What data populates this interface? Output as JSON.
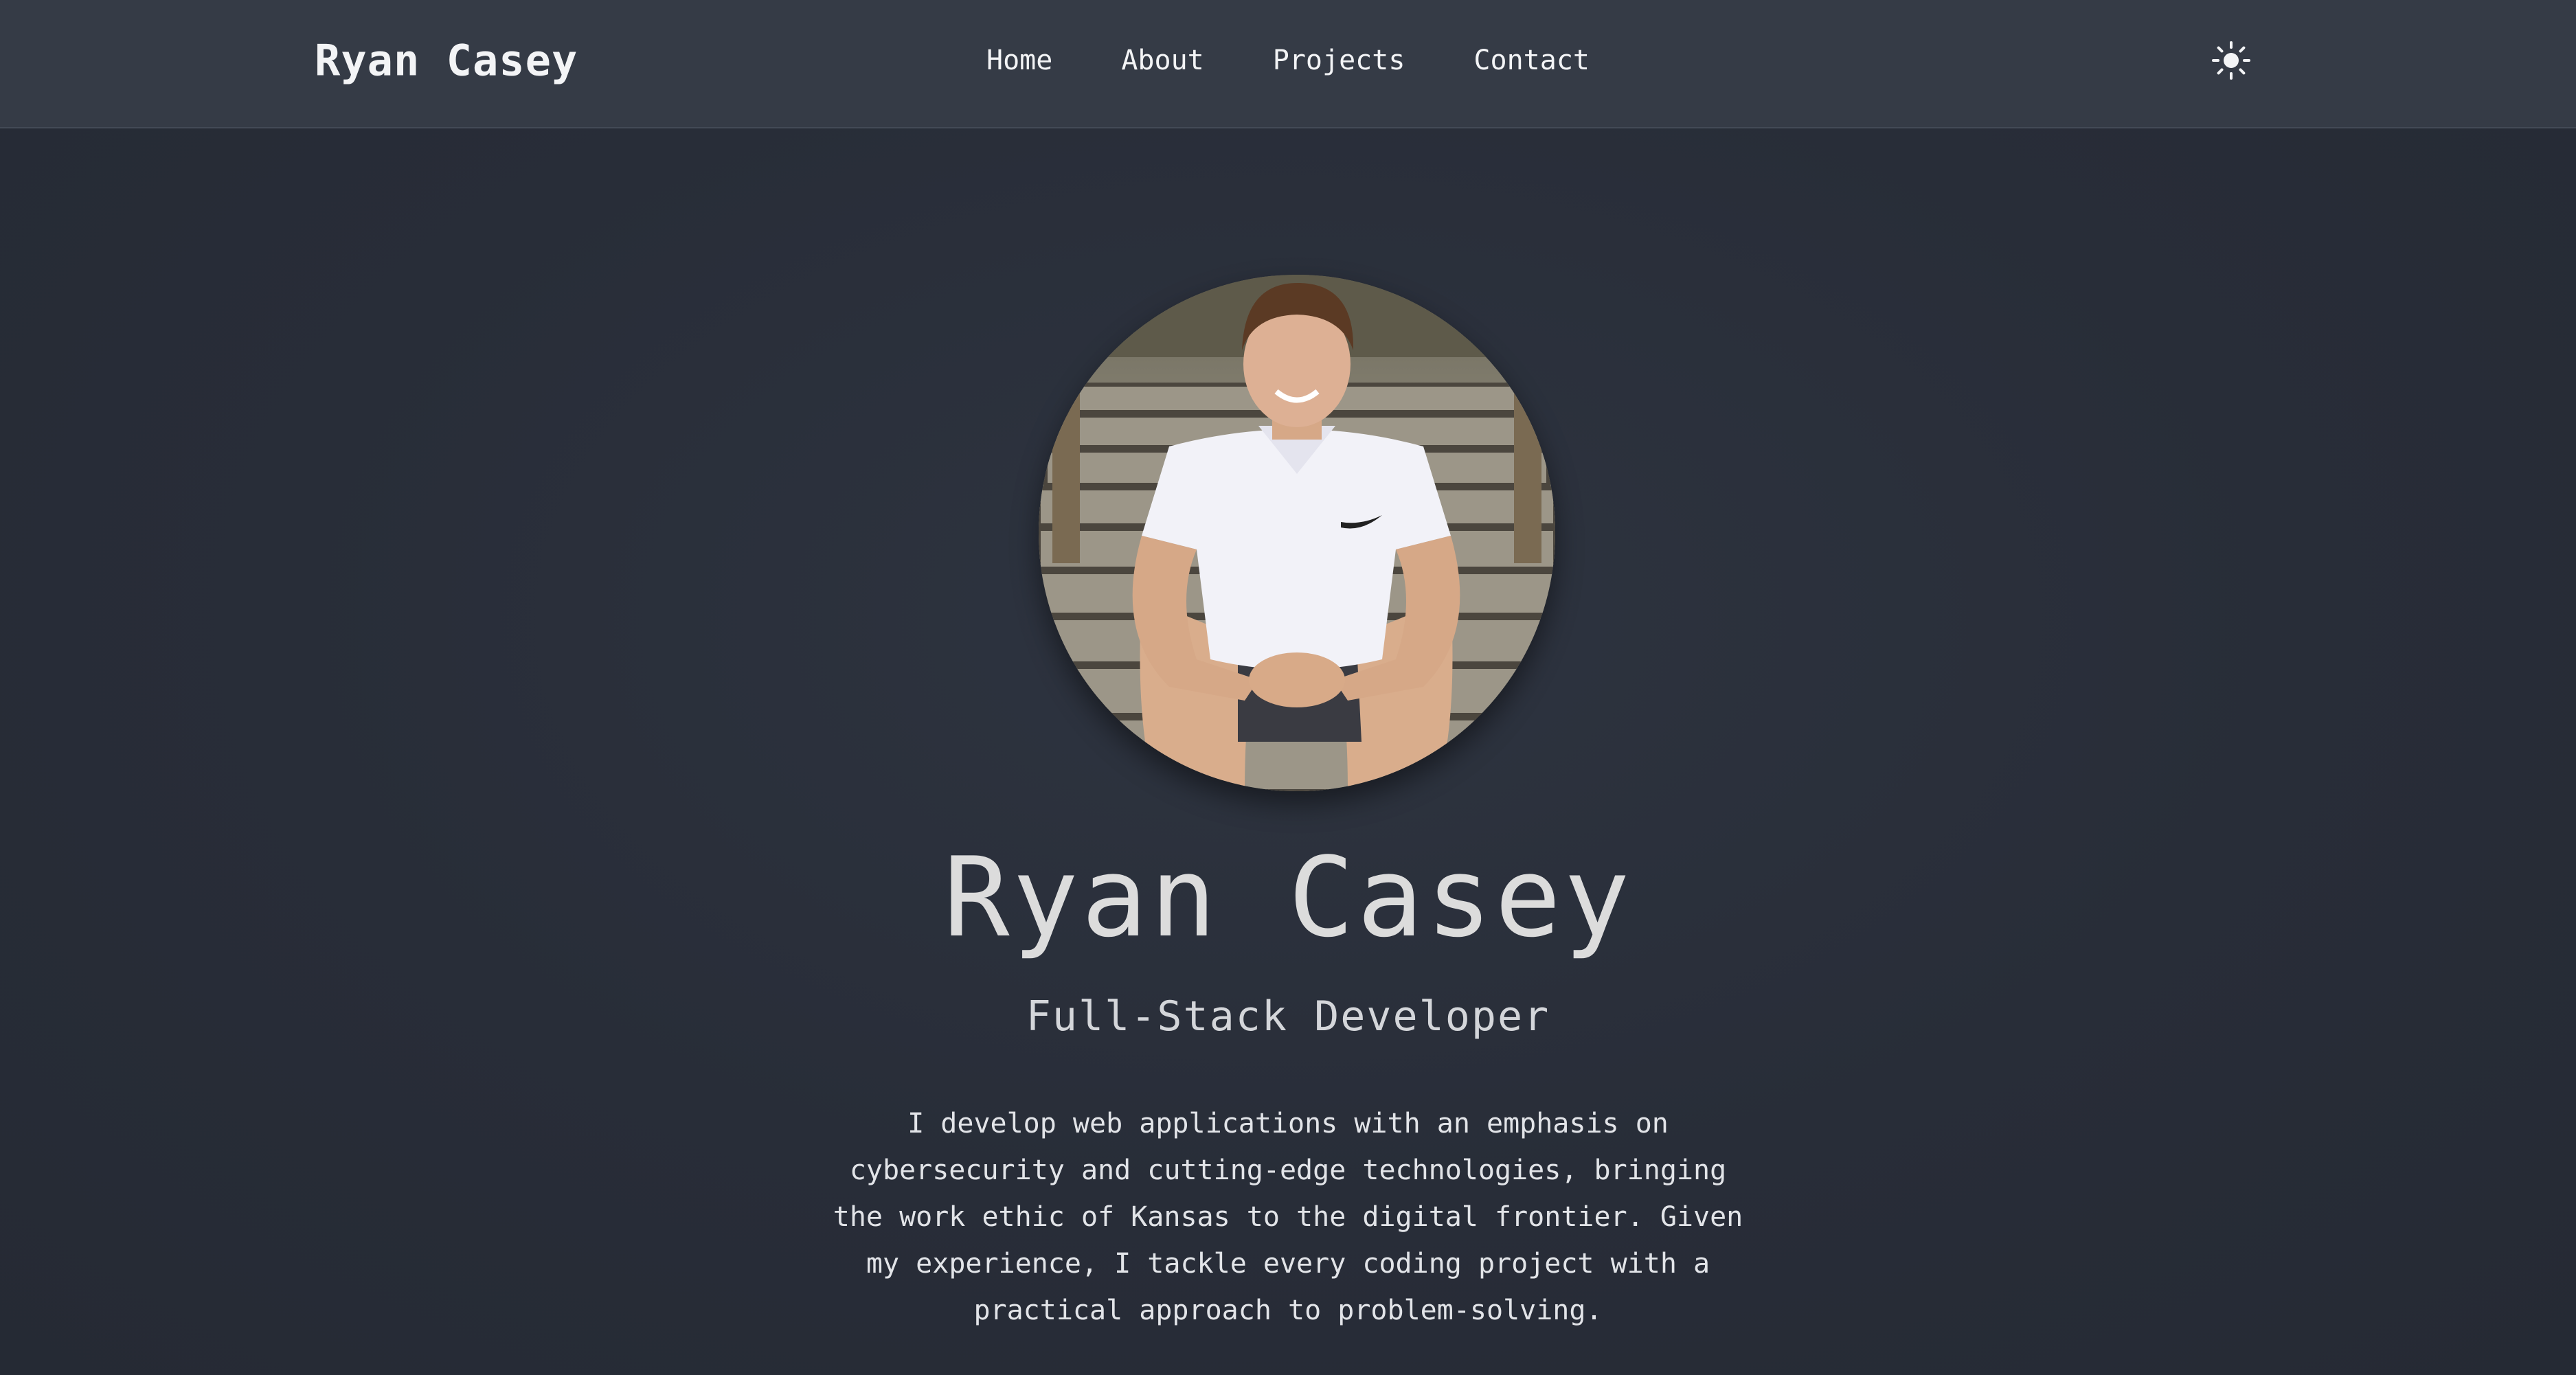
{
  "nav": {
    "brand": "Ryan Casey",
    "links": [
      {
        "label": "Home"
      },
      {
        "label": "About"
      },
      {
        "label": "Projects"
      },
      {
        "label": "Contact"
      }
    ],
    "theme_icon": "sun-icon"
  },
  "hero": {
    "photo_icon": "profile-photo",
    "name": "Ryan Casey",
    "role": "Full-Stack Developer",
    "bio": "I develop web applications with an emphasis on cybersecurity and cutting-edge technologies, bringing the work ethic of Kansas to the digital frontier. Given my experience, I tackle every coding project with a practical approach to problem-solving."
  },
  "colors": {
    "navbar_bg": "#353b46",
    "page_bg": "#2b303b",
    "text": "#e5e7eb",
    "accent_shirt": "#f2f2f8"
  }
}
